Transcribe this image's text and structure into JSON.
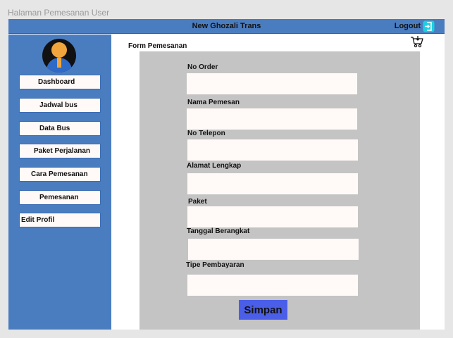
{
  "page_label": "Halaman Pemesanan User",
  "header": {
    "title": "New Ghozali Trans",
    "logout_label": "Logout"
  },
  "sidebar": {
    "items": [
      {
        "label": "Dashboard"
      },
      {
        "label": "Jadwal bus"
      },
      {
        "label": "Data Bus"
      },
      {
        "label": "Paket Perjalanan"
      },
      {
        "label": "Cara Pemesanan"
      },
      {
        "label": "Pemesanan"
      },
      {
        "label": "Edit Profil"
      }
    ]
  },
  "form": {
    "title": "Form Pemesanan",
    "fields": [
      {
        "label": "No Order",
        "value": ""
      },
      {
        "label": "Nama Pemesan",
        "value": ""
      },
      {
        "label": "No Telepon",
        "value": ""
      },
      {
        "label": "Alamat Lengkap",
        "value": ""
      },
      {
        "label": "Paket",
        "value": ""
      },
      {
        "label": "Tanggal Berangkat",
        "value": ""
      },
      {
        "label": "Tipe Pembayaran",
        "value": ""
      }
    ],
    "submit_label": "Simpan"
  },
  "colors": {
    "header": "#4a7cc0",
    "sidebar": "#4a7cc0",
    "panel": "#c4c4c4",
    "submit": "#4a5ee8",
    "input": "#fffaf8"
  }
}
